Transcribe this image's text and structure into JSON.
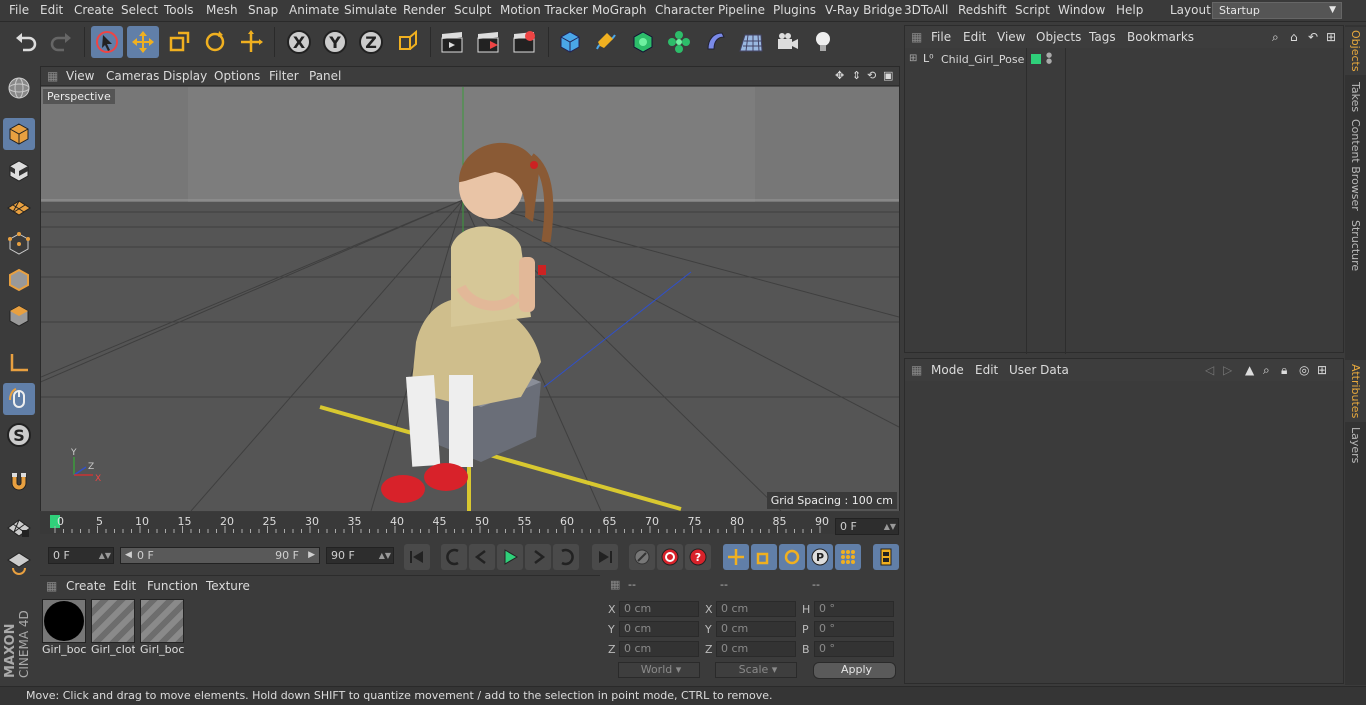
{
  "menu": [
    "File",
    "Edit",
    "Create",
    "Select",
    "Tools",
    "Mesh",
    "Snap",
    "Animate",
    "Simulate",
    "Render",
    "Sculpt",
    "Motion Tracker",
    "MoGraph",
    "Character",
    "Pipeline",
    "Plugins",
    "V-Ray Bridge",
    "3DToAll",
    "Redshift",
    "Script",
    "Window",
    "Help"
  ],
  "layout": {
    "label": "Layout:",
    "value": "Startup"
  },
  "viewport": {
    "menu": [
      "View",
      "Cameras",
      "Display",
      "Options",
      "Filter",
      "Panel"
    ],
    "camera_label": "Perspective",
    "grid_spacing": "Grid Spacing : 100 cm",
    "axis_x": "X",
    "axis_y": "Y",
    "axis_z": "Z"
  },
  "timeline": {
    "ticks": [
      "0",
      "5",
      "10",
      "15",
      "20",
      "25",
      "30",
      "35",
      "40",
      "45",
      "50",
      "55",
      "60",
      "65",
      "70",
      "75",
      "80",
      "85",
      "90"
    ],
    "current_frame": "0 F",
    "start_field": "0 F",
    "range_start": "0 F",
    "range_end": "90 F",
    "end_field": "90 F"
  },
  "materials": {
    "menu": [
      "Create",
      "Edit",
      "Function",
      "Texture"
    ],
    "items": [
      {
        "label": "Girl_boc",
        "kind": "sphere"
      },
      {
        "label": "Girl_clot",
        "kind": "stripes"
      },
      {
        "label": "Girl_boc",
        "kind": "stripes"
      }
    ]
  },
  "coordinates": {
    "headers": [
      "--",
      "--",
      "--"
    ],
    "rows": [
      {
        "l1": "X",
        "v1": "0 cm",
        "l2": "X",
        "v2": "0 cm",
        "l3": "H",
        "v3": "0 °"
      },
      {
        "l1": "Y",
        "v1": "0 cm",
        "l2": "Y",
        "v2": "0 cm",
        "l3": "P",
        "v3": "0 °"
      },
      {
        "l1": "Z",
        "v1": "0 cm",
        "l2": "Z",
        "v2": "0 cm",
        "l3": "B",
        "v3": "0 °"
      }
    ],
    "world": "World",
    "scale": "Scale",
    "apply": "Apply"
  },
  "objects": {
    "menu": [
      "File",
      "Edit",
      "View",
      "Objects",
      "Tags",
      "Bookmarks"
    ],
    "items": [
      {
        "name": "Child_Girl_Pose"
      }
    ]
  },
  "attributes": {
    "menu": [
      "Mode",
      "Edit",
      "User Data"
    ]
  },
  "side_tabs": [
    "Objects",
    "Takes",
    "Content Browser",
    "Structure",
    "Attributes",
    "Layers"
  ],
  "brand": {
    "maxon": "MAXON",
    "product": "CINEMA 4D"
  },
  "status": "Move: Click and drag to move elements. Hold down SHIFT to quantize movement / add to the selection in point mode, CTRL to remove."
}
